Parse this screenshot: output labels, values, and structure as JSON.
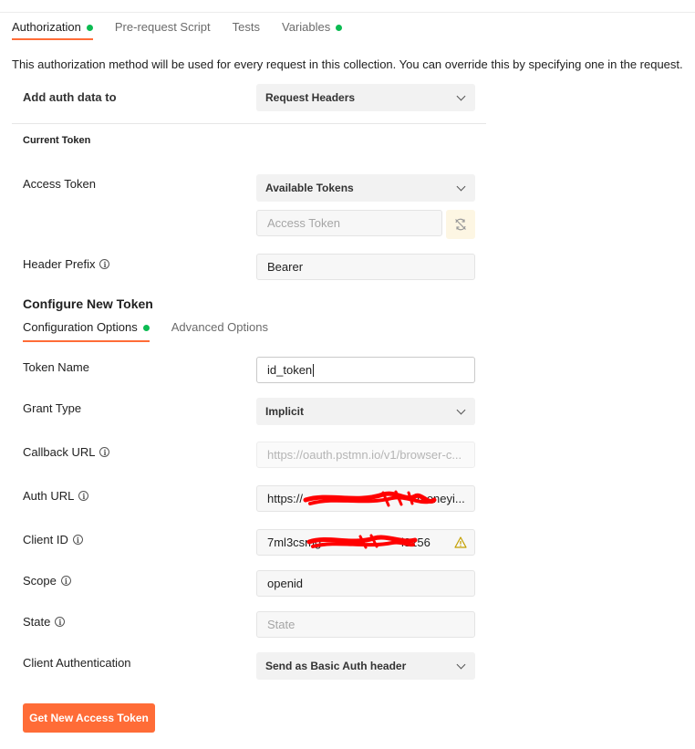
{
  "tabs": [
    {
      "label": "Authorization",
      "active": true,
      "dot": true
    },
    {
      "label": "Pre-request Script",
      "active": false,
      "dot": false
    },
    {
      "label": "Tests",
      "active": false,
      "dot": false
    },
    {
      "label": "Variables",
      "active": false,
      "dot": true
    }
  ],
  "description": "This authorization method will be used for every request in this collection. You can override this by specifying one in the request.",
  "add_auth": {
    "label": "Add auth data to",
    "value": "Request Headers"
  },
  "current_token": {
    "heading": "Current Token",
    "access_token_label": "Access Token",
    "available_tokens": "Available Tokens",
    "access_token_placeholder": "Access Token",
    "header_prefix_label": "Header Prefix",
    "header_prefix_value": "Bearer"
  },
  "configure": {
    "heading": "Configure New Token",
    "subtabs": [
      {
        "label": "Configuration Options",
        "active": true,
        "dot": true
      },
      {
        "label": "Advanced Options",
        "active": false,
        "dot": false
      }
    ]
  },
  "fields": {
    "token_name": {
      "label": "Token Name",
      "value": "id_token"
    },
    "grant_type": {
      "label": "Grant Type",
      "value": "Implicit"
    },
    "callback_url": {
      "label": "Callback URL",
      "value": "https://oauth.pstmn.io/v1/browser-c..."
    },
    "auth_url": {
      "label": "Auth URL",
      "value": "https://",
      "value_suffix": "moneyi..."
    },
    "client_id": {
      "label": "Client ID",
      "value": "7ml3csmg",
      "value_suffix": "i3256"
    },
    "scope": {
      "label": "Scope",
      "value": "openid"
    },
    "state": {
      "label": "State",
      "placeholder": "State"
    },
    "client_auth": {
      "label": "Client Authentication",
      "value": "Send as Basic Auth header"
    }
  },
  "get_token_button": "Get New Access Token",
  "colors": {
    "accent": "#ff6c37",
    "status_dot": "#0cbb52",
    "warning": "#c4a000",
    "redaction": "#ff0000"
  },
  "icons": [
    "info-icon",
    "chevron-down-icon",
    "sync-icon",
    "warning-icon"
  ]
}
